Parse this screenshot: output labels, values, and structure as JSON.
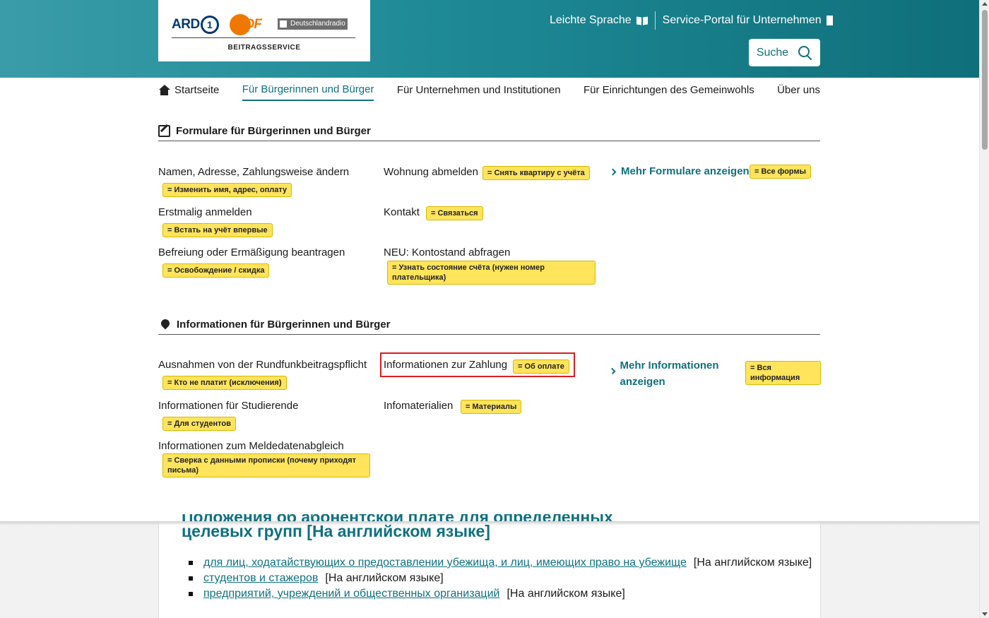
{
  "logo": {
    "ard": "ARD",
    "ard_mark": "1",
    "zdf": "ZDF",
    "dlf": "Deutschlandradio",
    "caption": "BEITRAGSSERVICE"
  },
  "top_links": {
    "easy_language": "Leichte Sprache",
    "business_portal": "Service-Portal für Unternehmen"
  },
  "search": {
    "label": "Suche"
  },
  "nav": {
    "home": "Startseite",
    "citizens": "Für Bürgerinnen und Bürger",
    "companies": "Für Unternehmen und Institutionen",
    "public_welfare": "Für Einrichtungen des Gemeinwohls",
    "about": "Über uns"
  },
  "forms": {
    "heading": "Formulare für Bürgerinnen und Bürger",
    "items": [
      {
        "label": "Namen, Adresse, Zahlungsweise ändern",
        "badge": "= Изменить имя, адрес, оплату"
      },
      {
        "label": "Erstmalig anmelden",
        "badge": "= Встать на учёт впервые"
      },
      {
        "label": "Befreiung oder Ermäßigung beantragen",
        "badge": "= Освобождение / скидка"
      },
      {
        "label": "Wohnung abmelden",
        "badge": "= Снять квартиру с учёта"
      },
      {
        "label": "Kontakt",
        "badge": "= Связаться"
      },
      {
        "label": "NEU: Kontostand abfragen",
        "badge": "= Узнать состояние счёта (нужен номер плательщика)"
      }
    ],
    "more": {
      "label": "Mehr Formulare anzeigen",
      "badge": "= Все формы"
    }
  },
  "info": {
    "heading": "Informationen für Bürgerinnen und Bürger",
    "items": [
      {
        "label": "Ausnahmen von der Rundfunkbeitragspflicht",
        "badge": "= Кто не платит (исключения)"
      },
      {
        "label": "Informationen für Studierende",
        "badge": "= Для студентов"
      },
      {
        "label": "Informationen zum Meldedatenabgleich",
        "badge": "= Сверка с данными прописки (почему приходят письма)"
      },
      {
        "label": "Informationen zur Zahlung",
        "badge": "= Об оплате"
      },
      {
        "label": "Infomaterialien",
        "badge": "= Материалы"
      }
    ],
    "more": {
      "label": "Mehr Informationen anzeigen",
      "badge": "= Вся информация"
    }
  },
  "lower": {
    "title_line1": "Положения об абонентской плате для определенных",
    "title_line2": "целевых групп [На английском языке]",
    "items": [
      {
        "link": "для лиц, ходатайствующих о предоставлении убежища, и лиц, имеющих право на убежище",
        "suffix": "[На английском языке]"
      },
      {
        "link": "студентов и стажеров",
        "suffix": "[На английском языке]"
      },
      {
        "link": "предприятий, учреждений и общественных организаций",
        "suffix": "[На английском языке]"
      }
    ]
  }
}
